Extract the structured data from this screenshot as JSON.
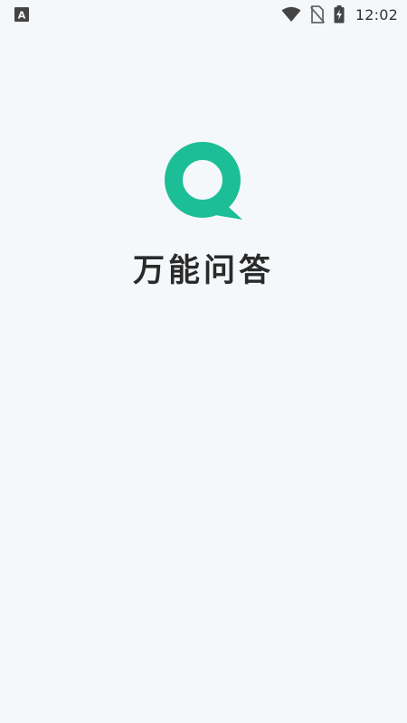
{
  "status_bar": {
    "time": "12:02",
    "icons": [
      "accessibility-icon",
      "wifi-icon",
      "no-sim-icon",
      "battery-charging-icon"
    ],
    "accessibility_glyph": "A"
  },
  "splash": {
    "title": "万能问答",
    "logo_icon": "speech-bubble-logo-icon",
    "accent_color": "#1cbe97",
    "background_color": "#f5f8fa"
  }
}
